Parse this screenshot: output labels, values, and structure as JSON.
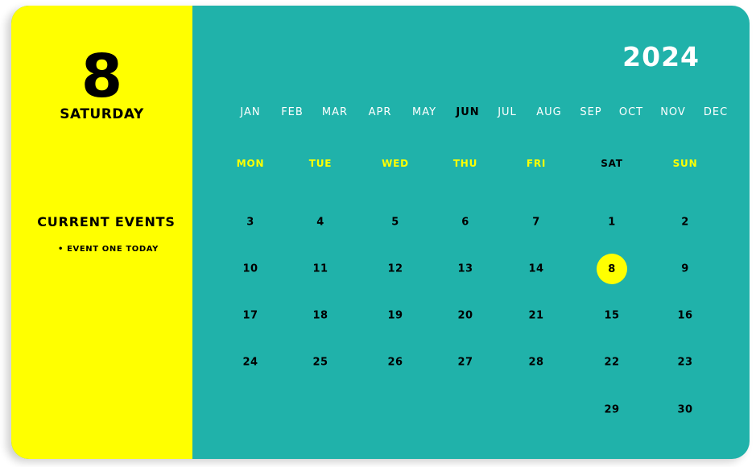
{
  "sidebar": {
    "day_number": "8",
    "weekday": "SATURDAY",
    "events_title": "CURRENT EVENTS",
    "events": [
      "EVENT ONE TODAY"
    ]
  },
  "calendar": {
    "year": "2024",
    "months": [
      "JAN",
      "FEB",
      "MAR",
      "APR",
      "MAY",
      "JUN",
      "JUL",
      "AUG",
      "SEP",
      "OCT",
      "NOV",
      "DEC"
    ],
    "active_month": "JUN",
    "weekdays": [
      "MON",
      "TUE",
      "WED",
      "THU",
      "FRI",
      "SAT",
      "SUN"
    ],
    "weeks": [
      [
        "3",
        "4",
        "5",
        "6",
        "7",
        "1",
        "2"
      ],
      [
        "10",
        "11",
        "12",
        "13",
        "14",
        "8",
        "9"
      ],
      [
        "17",
        "18",
        "19",
        "20",
        "21",
        "15",
        "16"
      ],
      [
        "24",
        "25",
        "26",
        "27",
        "28",
        "22",
        "23"
      ],
      [
        "",
        "",
        "",
        "",
        "",
        "29",
        "30"
      ]
    ],
    "selected_day": "8"
  },
  "colors": {
    "sidebar_bg": "#ffff00",
    "calendar_bg": "#20b2aa",
    "weekday_text": "#ffff00",
    "month_text": "#ffffff",
    "highlight": "#ffff00"
  }
}
